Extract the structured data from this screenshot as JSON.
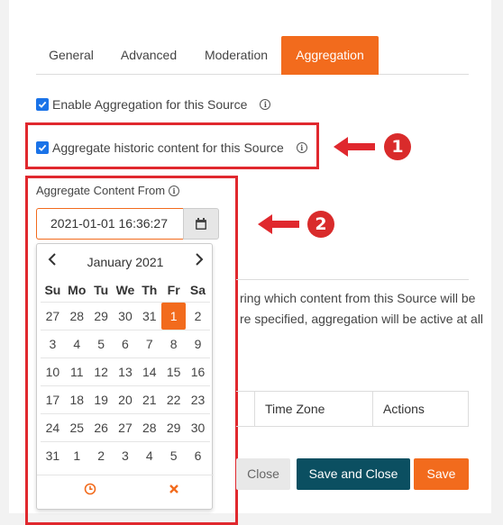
{
  "tabs": [
    "General",
    "Advanced",
    "Moderation",
    "Aggregation"
  ],
  "enable_aggregation_label": "Enable Aggregation for this Source",
  "historic_label": "Aggregate historic content for this Source",
  "field_label": "Aggregate Content From",
  "date_value": "2021-01-01 16:36:27",
  "annotations": {
    "one": "1",
    "two": "2"
  },
  "bg_text": {
    "line1": "ring which content from this Source will be",
    "line2": "re specified, aggregation will be active at all"
  },
  "table_headers": [
    "Time Zone",
    "Actions"
  ],
  "buttons": {
    "close": "Close",
    "save_close": "Save and Close",
    "save": "Save"
  },
  "calendar": {
    "month": "January 2021",
    "days": [
      "Su",
      "Mo",
      "Tu",
      "We",
      "Th",
      "Fr",
      "Sa"
    ],
    "weeks": [
      [
        "27",
        "28",
        "29",
        "30",
        "31",
        "1",
        "2"
      ],
      [
        "3",
        "4",
        "5",
        "6",
        "7",
        "8",
        "9"
      ],
      [
        "10",
        "11",
        "12",
        "13",
        "14",
        "15",
        "16"
      ],
      [
        "17",
        "18",
        "19",
        "20",
        "21",
        "22",
        "23"
      ],
      [
        "24",
        "25",
        "26",
        "27",
        "28",
        "29",
        "30"
      ],
      [
        "31",
        "1",
        "2",
        "3",
        "4",
        "5",
        "6"
      ]
    ],
    "selected": "1"
  },
  "colors": {
    "accent": "#f26b1d",
    "checkbox": "#1a73e8",
    "annotation_red": "#e0282e",
    "save_close_bg": "#0b4f61"
  }
}
